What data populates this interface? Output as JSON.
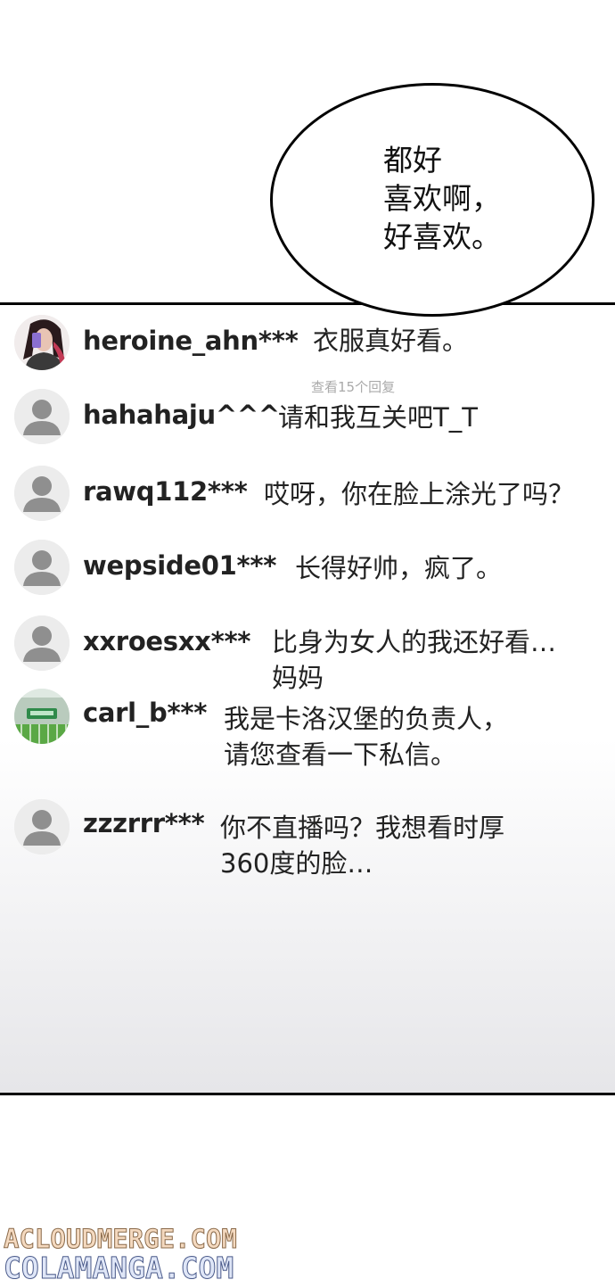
{
  "speech_bubble": {
    "text": "都好\n喜欢啊，\n好喜欢。"
  },
  "view_replies": "查看15个回复",
  "comments": [
    {
      "username": "heroine_ahn***",
      "text": "衣服真好看。",
      "avatar": "photo-woman-selfie"
    },
    {
      "username": "hahahaju^^^",
      "text": "请和我互关吧T_T",
      "avatar": "default-person-icon"
    },
    {
      "username": "rawq112***",
      "text": "哎呀，你在脸上涂光了吗？",
      "avatar": "default-person-icon"
    },
    {
      "username": "wepside01***",
      "text": "长得好帅，疯了。",
      "avatar": "default-person-icon"
    },
    {
      "username": "xxroesxx***",
      "text": "比身为女人的我还好看…\n妈妈",
      "avatar": "default-person-icon"
    },
    {
      "username": "carl_b***",
      "text": "我是卡洛汉堡的负责人，\n请您查看一下私信。",
      "avatar": "photo-storefront"
    },
    {
      "username": "zzzrrr***",
      "text": "你不直播吗？我想看时厚\n360度的脸…",
      "avatar": "default-person-icon"
    }
  ],
  "watermarks": [
    "ACLOUDMERGE.COM",
    "COLAMANGA.COM"
  ],
  "colors": {
    "avatar_gray": "#8f8f8f",
    "border": "#000000",
    "text": "#222222",
    "muted": "#aaaaaa"
  }
}
